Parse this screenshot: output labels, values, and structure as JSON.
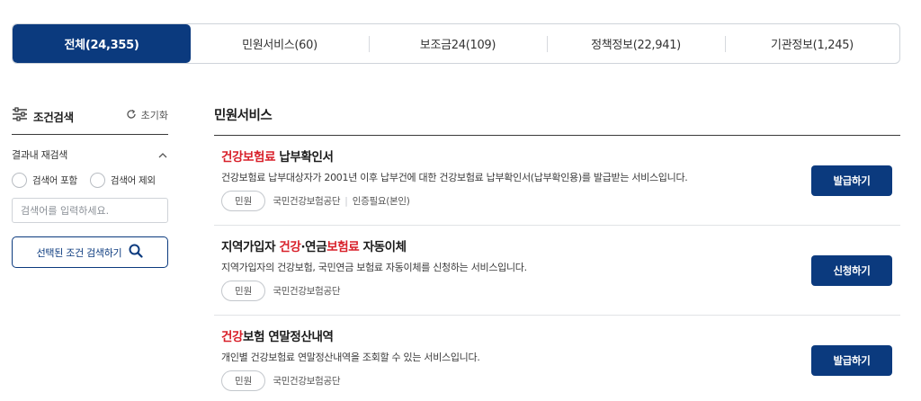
{
  "tabs": [
    {
      "label": "전체(24,355)",
      "active": true
    },
    {
      "label": "민원서비스(60)",
      "active": false
    },
    {
      "label": "보조금24(109)",
      "active": false
    },
    {
      "label": "정책정보(22,941)",
      "active": false
    },
    {
      "label": "기관정보(1,245)",
      "active": false
    }
  ],
  "filter": {
    "title": "조건검색",
    "reset_label": "초기화",
    "refine_label": "결과내 재검색",
    "include_label": "검색어 포함",
    "exclude_label": "검색어 제외",
    "search_placeholder": "검색어를 입력하세요.",
    "search_button_label": "선택된 조건 검색하기"
  },
  "section_title": "민원서비스",
  "colors": {
    "brand": "#0b3a7e",
    "highlight": "#d8202a"
  },
  "results": [
    {
      "title_parts": {
        "highlight": "건강보험료",
        "rest": " 납부확인서"
      },
      "description": "건강보험료 납부대상자가 2001년 이후 납부건에 대한 건강보험료 납부확인서(납부확인용)를 발급받는 서비스입니다.",
      "tag": "민원",
      "org": "국민건강보험공단",
      "auth": "인증필요(본인)",
      "action_label": "발급하기"
    },
    {
      "title_parts": {
        "pre": "지역가입자 ",
        "highlight1": "건강",
        "mid": "·연금",
        "highlight2": "보험료",
        "post": " 자동이체"
      },
      "description": "지역가입자의 건강보험, 국민연금 보험료 자동이체를 신청하는 서비스입니다.",
      "tag": "민원",
      "org": "국민건강보험공단",
      "action_label": "신청하기"
    },
    {
      "title_parts": {
        "highlight": "건강",
        "rest": "보험 연말정산내역"
      },
      "description": "개인별 건강보험료 연말정산내역을 조회할 수 있는 서비스입니다.",
      "tag": "민원",
      "org": "국민건강보험공단",
      "action_label": "발급하기"
    }
  ]
}
